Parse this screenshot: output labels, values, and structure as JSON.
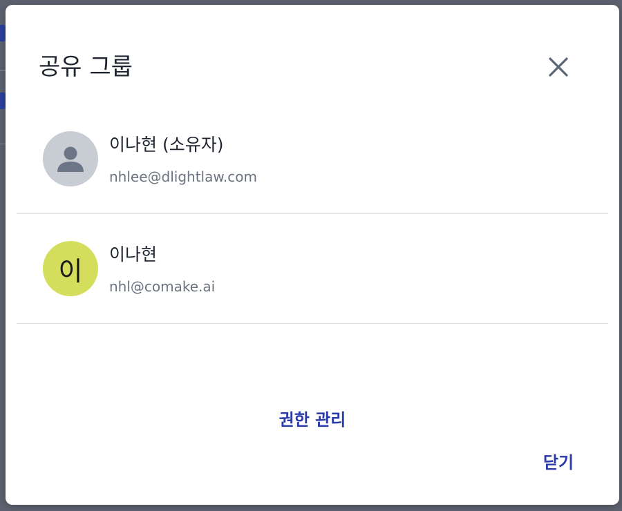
{
  "dialog": {
    "title": "공유 그룹",
    "close_icon": "close-icon",
    "manage_permissions_label": "권한 관리",
    "close_label": "닫기"
  },
  "members": [
    {
      "name": "이나현 (소유자)",
      "email": "nhlee@dlightlaw.com",
      "avatar": {
        "type": "icon",
        "icon": "person-icon",
        "color": "#c8ccd3"
      }
    },
    {
      "name": "이나현",
      "email": "nhl@comake.ai",
      "avatar": {
        "type": "initial",
        "initial": "이",
        "color": "#d4de5c"
      }
    }
  ],
  "colors": {
    "accent": "#2a3aa8",
    "divider": "#dcdfe3",
    "text_primary": "#1f2430",
    "text_secondary": "#6b7280"
  }
}
